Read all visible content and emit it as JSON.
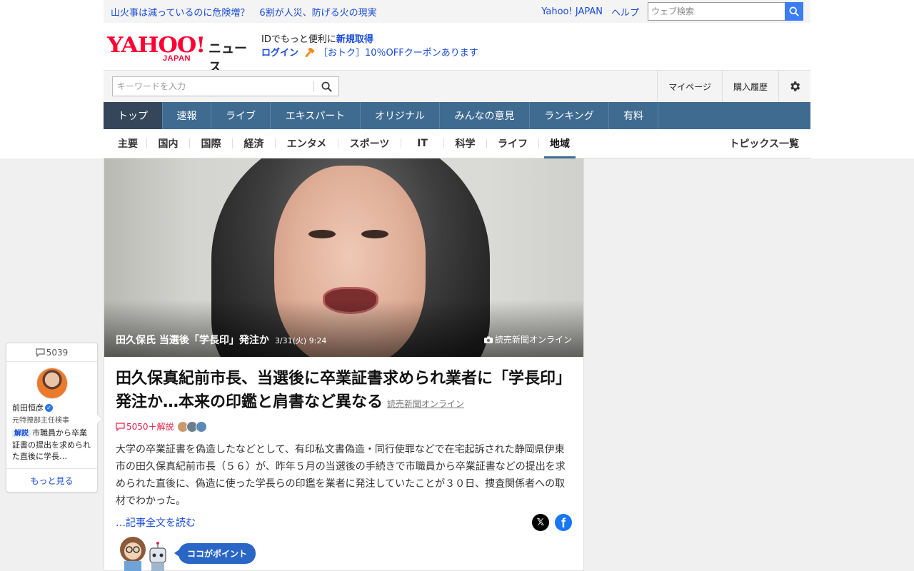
{
  "topbar": {
    "headline_1": "山火事は減っているのに危険増？",
    "headline_2": "6割が人災、防げる火の現実",
    "yahoo_japan": "Yahoo! JAPAN",
    "help": "ヘルプ",
    "web_search_placeholder": "ウェブ検索"
  },
  "logo": {
    "yahoo": "YAHOO!",
    "japan": "JAPAN",
    "news": "ニュース"
  },
  "promo": {
    "line1_prefix": "IDでもっと便利に",
    "line1_link": "新規取得",
    "login": "ログイン",
    "coupon": "［おトク］10％OFFクーポンあります"
  },
  "search": {
    "placeholder": "キーワードを入力",
    "mypage": "マイページ",
    "history": "購入履歴"
  },
  "mainnav": [
    {
      "label": "トップ"
    },
    {
      "label": "速報"
    },
    {
      "label": "ライブ"
    },
    {
      "label": "エキスパート"
    },
    {
      "label": "オリジナル"
    },
    {
      "label": "みんなの意見"
    },
    {
      "label": "ランキング"
    },
    {
      "label": "有料"
    }
  ],
  "subnav": [
    {
      "label": "主要"
    },
    {
      "label": "国内"
    },
    {
      "label": "国際"
    },
    {
      "label": "経済"
    },
    {
      "label": "エンタメ"
    },
    {
      "label": "スポーツ"
    },
    {
      "label": "IT"
    },
    {
      "label": "科学"
    },
    {
      "label": "ライフ"
    },
    {
      "label": "地域"
    }
  ],
  "subnav_topics": "トピックス一覧",
  "article": {
    "photo_caption": "田久保氏 当選後「学長印」発注か",
    "photo_time": "3/31(火) 9:24",
    "photo_source": "読売新聞オンライン",
    "headline": "田久保真紀前市長、当選後に卒業証書求められ業者に「学長印」発注か…本来の印鑑と肩書など異なる",
    "publisher": "読売新聞オンライン",
    "comments": "5050＋解説",
    "body": "大学の卒業証書を偽造したなどとして、有印私文書偽造・同行使罪などで在宅起訴された静岡県伊東市の田久保真紀前市長（５６）が、昨年５月の当選後の手続きで市職員から卒業証書などの提出を求められた直後に、偽造に使った学長らの印鑑を業者に発注していたことが３０日、捜査関係者への取材でわかった。",
    "read_more": "…記事全文を読む",
    "share_x": "𝕏",
    "share_fb": "f",
    "point_label": "ココがポイント"
  },
  "comment_card": {
    "count": "5039",
    "name": "前田恒彦",
    "role": "元特捜部主任検事",
    "tag": "解説",
    "text": "市職員から卒業証書の提出を求められた直後に学長…",
    "more": "もっと見る"
  },
  "colors": {
    "accent_blue": "#3f6b91",
    "link": "#1a4bd6",
    "brand_red": "#ff0033",
    "comment_red": "#e0244a"
  }
}
